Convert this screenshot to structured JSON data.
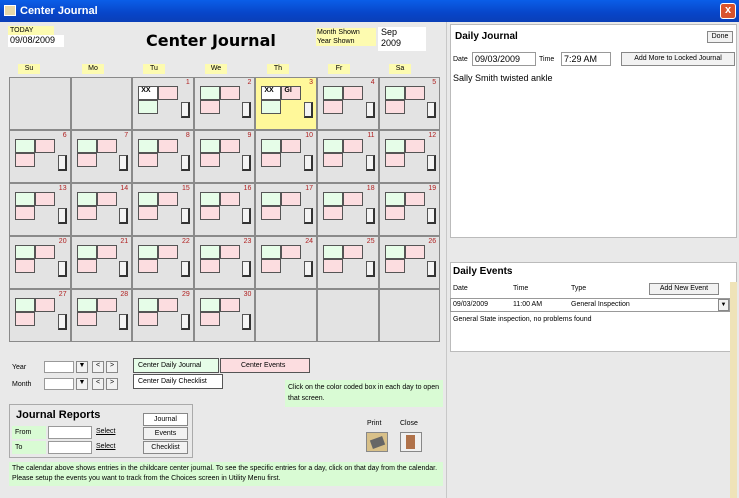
{
  "window": {
    "title": "Center Journal",
    "close": "x"
  },
  "header": {
    "today_label": "TODAY",
    "today_value": "09/08/2009",
    "title": "Center Journal",
    "month_shown_label": "Month Shown",
    "year_shown_label": "Year Shown",
    "month_shown": "Sep",
    "year_shown": "2009"
  },
  "days_of_week": [
    "Su",
    "Mo",
    "Tu",
    "We",
    "Th",
    "Fr",
    "Sa"
  ],
  "calendar": {
    "day_numbers": [
      "1",
      "2",
      "3",
      "4",
      "5",
      "6",
      "7",
      "8",
      "9",
      "10",
      "11",
      "12",
      "13",
      "14",
      "15",
      "16",
      "17",
      "18",
      "19",
      "20",
      "21",
      "22",
      "23",
      "24",
      "25",
      "26",
      "27",
      "28",
      "29",
      "30"
    ],
    "cell_marks": {
      "tu1": "XX",
      "th3a": "XX",
      "th3b": "GI"
    }
  },
  "selectors": {
    "year_label": "Year",
    "month_label": "Month",
    "prev": "<",
    "next": ">",
    "dropdown": "▼"
  },
  "legend": {
    "daily_journal": "Center Daily Journal",
    "events": "Center Events",
    "checklist": "Center Daily Checklist",
    "hint": "Click on the color coded box in each day to open that screen."
  },
  "reports": {
    "title": "Journal Reports",
    "from_label": "From",
    "to_label": "To",
    "select": "Select",
    "journal": "Journal",
    "events": "Events",
    "checklist": "Checklist",
    "print": "Print",
    "close": "Close"
  },
  "footer": "The calendar above shows entries in the childcare center journal. To see the specific entries for a day, click on that day from the calendar. Please setup the events you want to track from the Choices screen in Utility Menu first.",
  "daily_journal": {
    "title": "Daily Journal",
    "done": "Done",
    "date_label": "Date",
    "date": "09/03/2009",
    "time_label": "Time",
    "time": "7:29 AM",
    "add_more": "Add More to Locked Journal",
    "entry": "Sally Smith twisted ankle"
  },
  "daily_events": {
    "title": "Daily Events",
    "columns": [
      "Date",
      "Time",
      "Type"
    ],
    "add_new": "Add New Event",
    "row": {
      "date": "09/03/2009",
      "time": "11:00 AM",
      "type": "General Inspection"
    },
    "note": "General State inspection, no problems found"
  },
  "colors": {
    "titlebar": "#0a5ee8",
    "yellow": "#fdfbb0",
    "pink": "#fcdde0",
    "green": "#e6fde8",
    "footer": "#d9fbd4"
  }
}
